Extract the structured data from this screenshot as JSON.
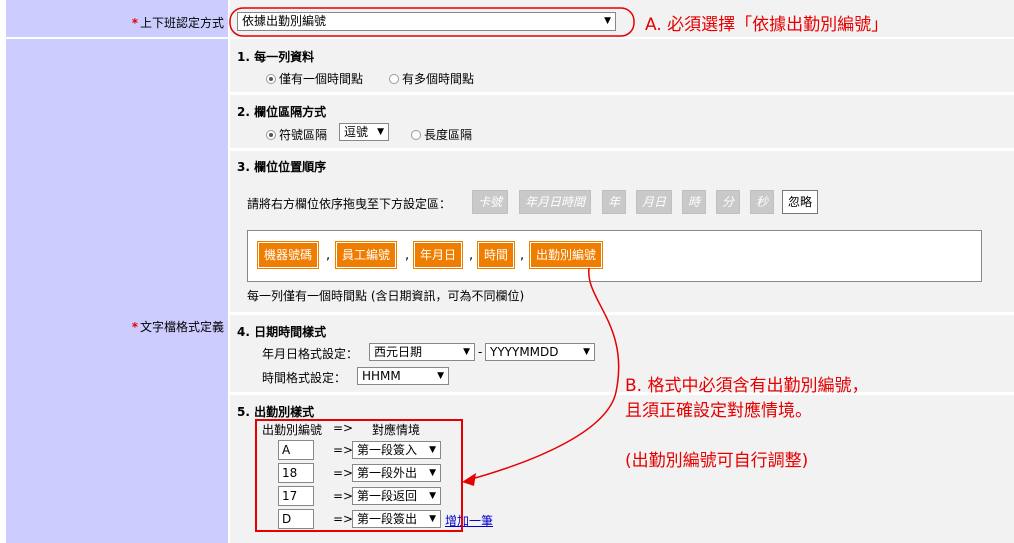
{
  "rows": {
    "checkin_method": {
      "label": "上下班認定方式",
      "value": "依據出勤別編號"
    },
    "text_format": {
      "label": "文字檔格式定義"
    }
  },
  "sections": {
    "per_row": {
      "title": "1. 每一列資料",
      "option_single": "僅有一個時間點",
      "option_multi": "有多個時間點"
    },
    "separator": {
      "title": "2. 欄位區隔方式",
      "option_symbol": "符號區隔",
      "symbol_value": "逗號",
      "option_length": "長度區隔"
    },
    "order": {
      "title": "3. 欄位位置順序",
      "instruction": "請將右方欄位依序拖曳至下方設定區：",
      "available_chips": [
        "卡號",
        "年月日時間",
        "年",
        "月日",
        "時",
        "分",
        "秒"
      ],
      "ignore_chip": "忽略",
      "selected_fields": [
        "機器號碼",
        "員工編號",
        "年月日",
        "時間",
        "出勤別編號"
      ],
      "separator_char": ",",
      "note": "每一列僅有一個時間點 (含日期資訊，可為不同欄位)"
    },
    "datetime": {
      "title": "4. 日期時間樣式",
      "date_label": "年月日格式設定：",
      "date_calendar": "西元日期",
      "dash": "-",
      "date_format": "YYYYMMDD",
      "time_label": "時間格式設定：",
      "time_format": "HHMM"
    },
    "attendance": {
      "title": "5. 出勤別樣式",
      "col_code": "出勤別編號",
      "arrow": "=>",
      "col_situation": "對應情境",
      "mappings": [
        {
          "code": "A",
          "situation": "第一段簽入"
        },
        {
          "code": "18",
          "situation": "第一段外出"
        },
        {
          "code": "17",
          "situation": "第一段返回"
        },
        {
          "code": "D",
          "situation": "第一段簽出"
        }
      ],
      "add_link": "增加一筆"
    }
  },
  "annotations": {
    "a": "A. 必須選擇「依據出勤別編號」",
    "b_line1": "B. 格式中必須含有出勤別編號，",
    "b_line2": "且須正確設定對應情境。",
    "b_line3": "(出勤別編號可自行調整)"
  },
  "colors": {
    "label_column": "#ccccff",
    "content_column": "#f2f2f2",
    "field_chip": "#ef7d00",
    "annotation": "#e60000",
    "required_star": "#e60000"
  }
}
